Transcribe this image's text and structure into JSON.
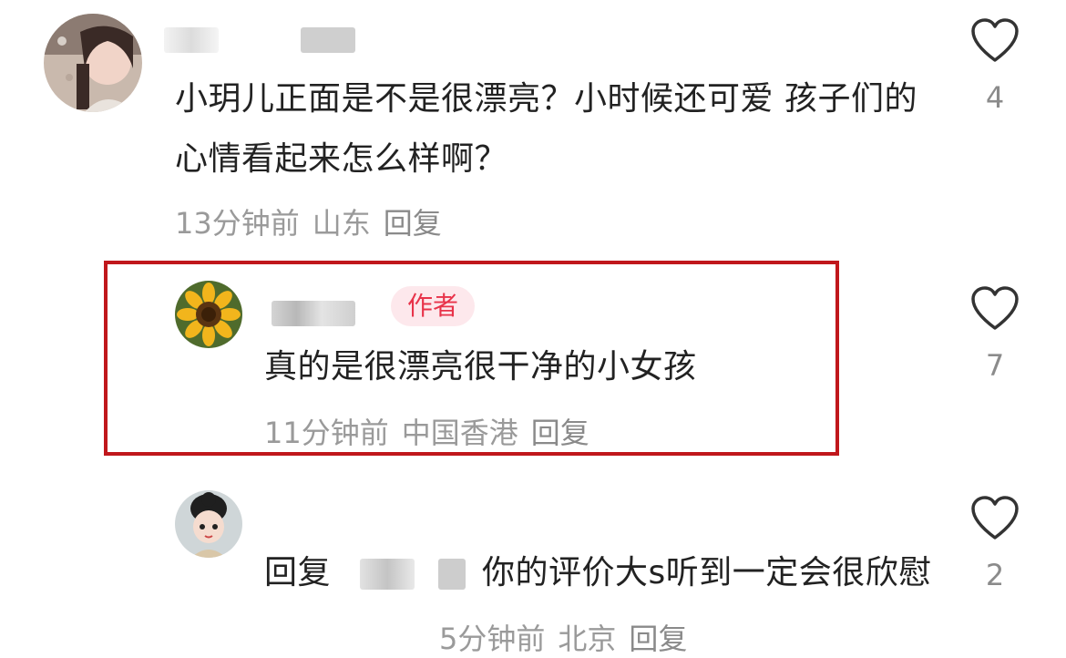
{
  "comments": [
    {
      "text": "小玥儿正面是不是很漂亮？小时候还可爱 孩子们的心情看起来怎么样啊？",
      "time": "13分钟前",
      "location": "山东",
      "reply_label": "回复",
      "likes": "4"
    },
    {
      "author_tag": "作者",
      "text": "真的是很漂亮很干净的小女孩",
      "time": "11分钟前",
      "location": "中国香港",
      "reply_label": "回复",
      "likes": "7"
    },
    {
      "reply_prefix": "回复",
      "text": "你的评价大s听到一定会很欣慰",
      "time": "5分钟前",
      "location": "北京",
      "reply_label": "回复",
      "likes": "2"
    }
  ]
}
